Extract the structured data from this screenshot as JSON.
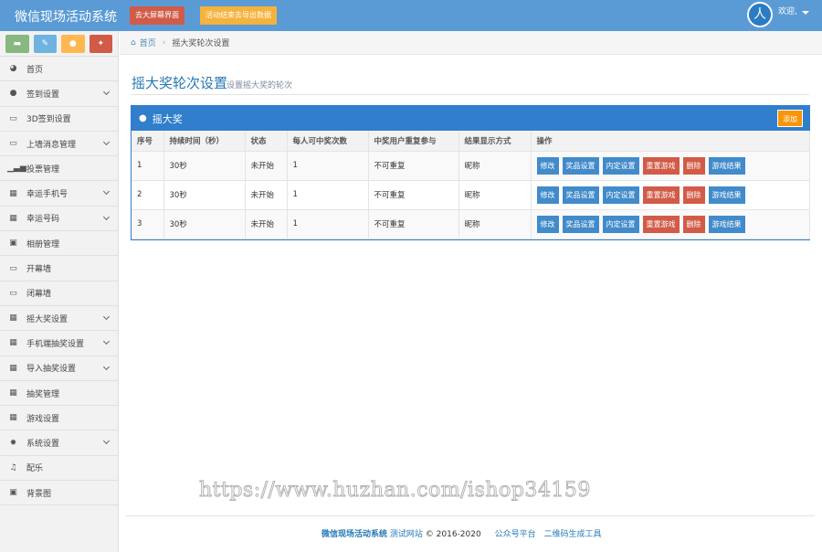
{
  "header": {
    "app_title": "微信现场活动系统",
    "btn_big_screen": "去大屏幕界面",
    "btn_export": "活动结束去导出数据",
    "welcome": "欢迎,",
    "avatar_glyph": "人"
  },
  "sidebar": {
    "shortcuts": [
      {
        "icon": "comment-icon",
        "glyph": "▬",
        "color": "#87b87f"
      },
      {
        "icon": "pencil-icon",
        "glyph": "✎",
        "color": "#6fb3e0"
      },
      {
        "icon": "users-icon",
        "glyph": "●",
        "color": "#ffb752"
      },
      {
        "icon": "cogs-icon",
        "glyph": "✦",
        "color": "#d15b47"
      }
    ],
    "items": [
      {
        "label": "首页",
        "icon": "dashboard-icon",
        "glyph": "◕",
        "arrow": false
      },
      {
        "label": "签到设置",
        "icon": "users-icon",
        "glyph": "●",
        "arrow": true
      },
      {
        "label": "3D签到设置",
        "icon": "desktop-icon",
        "glyph": "▭",
        "arrow": false
      },
      {
        "label": "上墙消息管理",
        "icon": "desktop-icon",
        "glyph": "▭",
        "arrow": true
      },
      {
        "label": "投票管理",
        "icon": "signal-icon",
        "glyph": "▁▃▅",
        "arrow": false
      },
      {
        "label": "幸运手机号",
        "icon": "gift-icon",
        "glyph": "▦",
        "arrow": true
      },
      {
        "label": "幸运号码",
        "icon": "gift-icon",
        "glyph": "▦",
        "arrow": true
      },
      {
        "label": "相册管理",
        "icon": "picture-icon",
        "glyph": "▣",
        "arrow": false
      },
      {
        "label": "开幕墙",
        "icon": "desktop-icon",
        "glyph": "▭",
        "arrow": false
      },
      {
        "label": "闭幕墙",
        "icon": "desktop-icon",
        "glyph": "▭",
        "arrow": false
      },
      {
        "label": "摇大奖设置",
        "icon": "gift-icon",
        "glyph": "▦",
        "arrow": true
      },
      {
        "label": "手机端抽奖设置",
        "icon": "gift-icon",
        "glyph": "▦",
        "arrow": true
      },
      {
        "label": "导入抽奖设置",
        "icon": "gift-icon",
        "glyph": "▦",
        "arrow": true
      },
      {
        "label": "抽奖管理",
        "icon": "gift-icon",
        "glyph": "▦",
        "arrow": false
      },
      {
        "label": "游戏设置",
        "icon": "gift-icon",
        "glyph": "▦",
        "arrow": false
      },
      {
        "label": "系统设置",
        "icon": "cog-icon",
        "glyph": "✹",
        "arrow": true
      },
      {
        "label": "配乐",
        "icon": "music-icon",
        "glyph": "♫",
        "arrow": false
      },
      {
        "label": "背景图",
        "icon": "picture-icon",
        "glyph": "▣",
        "arrow": false
      }
    ]
  },
  "breadcrumb": {
    "home": "首页",
    "current": "摇大奖轮次设置"
  },
  "page": {
    "title": "摇大奖轮次设置",
    "subtitle": "设置摇大奖的轮次"
  },
  "widget": {
    "title": "摇大奖",
    "add_label": "添加"
  },
  "table": {
    "headers": [
      "序号",
      "持续时间（秒）",
      "状态",
      "每人可中奖次数",
      "中奖用户重复参与",
      "结果显示方式",
      "操作"
    ],
    "rows": [
      [
        "1",
        "30秒",
        "未开始",
        "1",
        "不可重复",
        "昵称"
      ],
      [
        "2",
        "30秒",
        "未开始",
        "1",
        "不可重复",
        "昵称"
      ],
      [
        "3",
        "30秒",
        "未开始",
        "1",
        "不可重复",
        "昵称"
      ]
    ],
    "actions": [
      {
        "label": "修改",
        "color": "blue"
      },
      {
        "label": "奖品设置",
        "color": "blue"
      },
      {
        "label": "内定设置",
        "color": "blue"
      },
      {
        "label": "重置游戏",
        "color": "red"
      },
      {
        "label": "删除",
        "color": "red"
      },
      {
        "label": "游戏结果",
        "color": "blue"
      }
    ]
  },
  "watermark": "https://www.huzhan.com/ishop34159",
  "footer": {
    "brand": "微信现场活动系统",
    "site": "测试网站",
    "copyright": "© 2016-2020",
    "link1": "公众号平台",
    "link2": "二维码生成工具"
  }
}
